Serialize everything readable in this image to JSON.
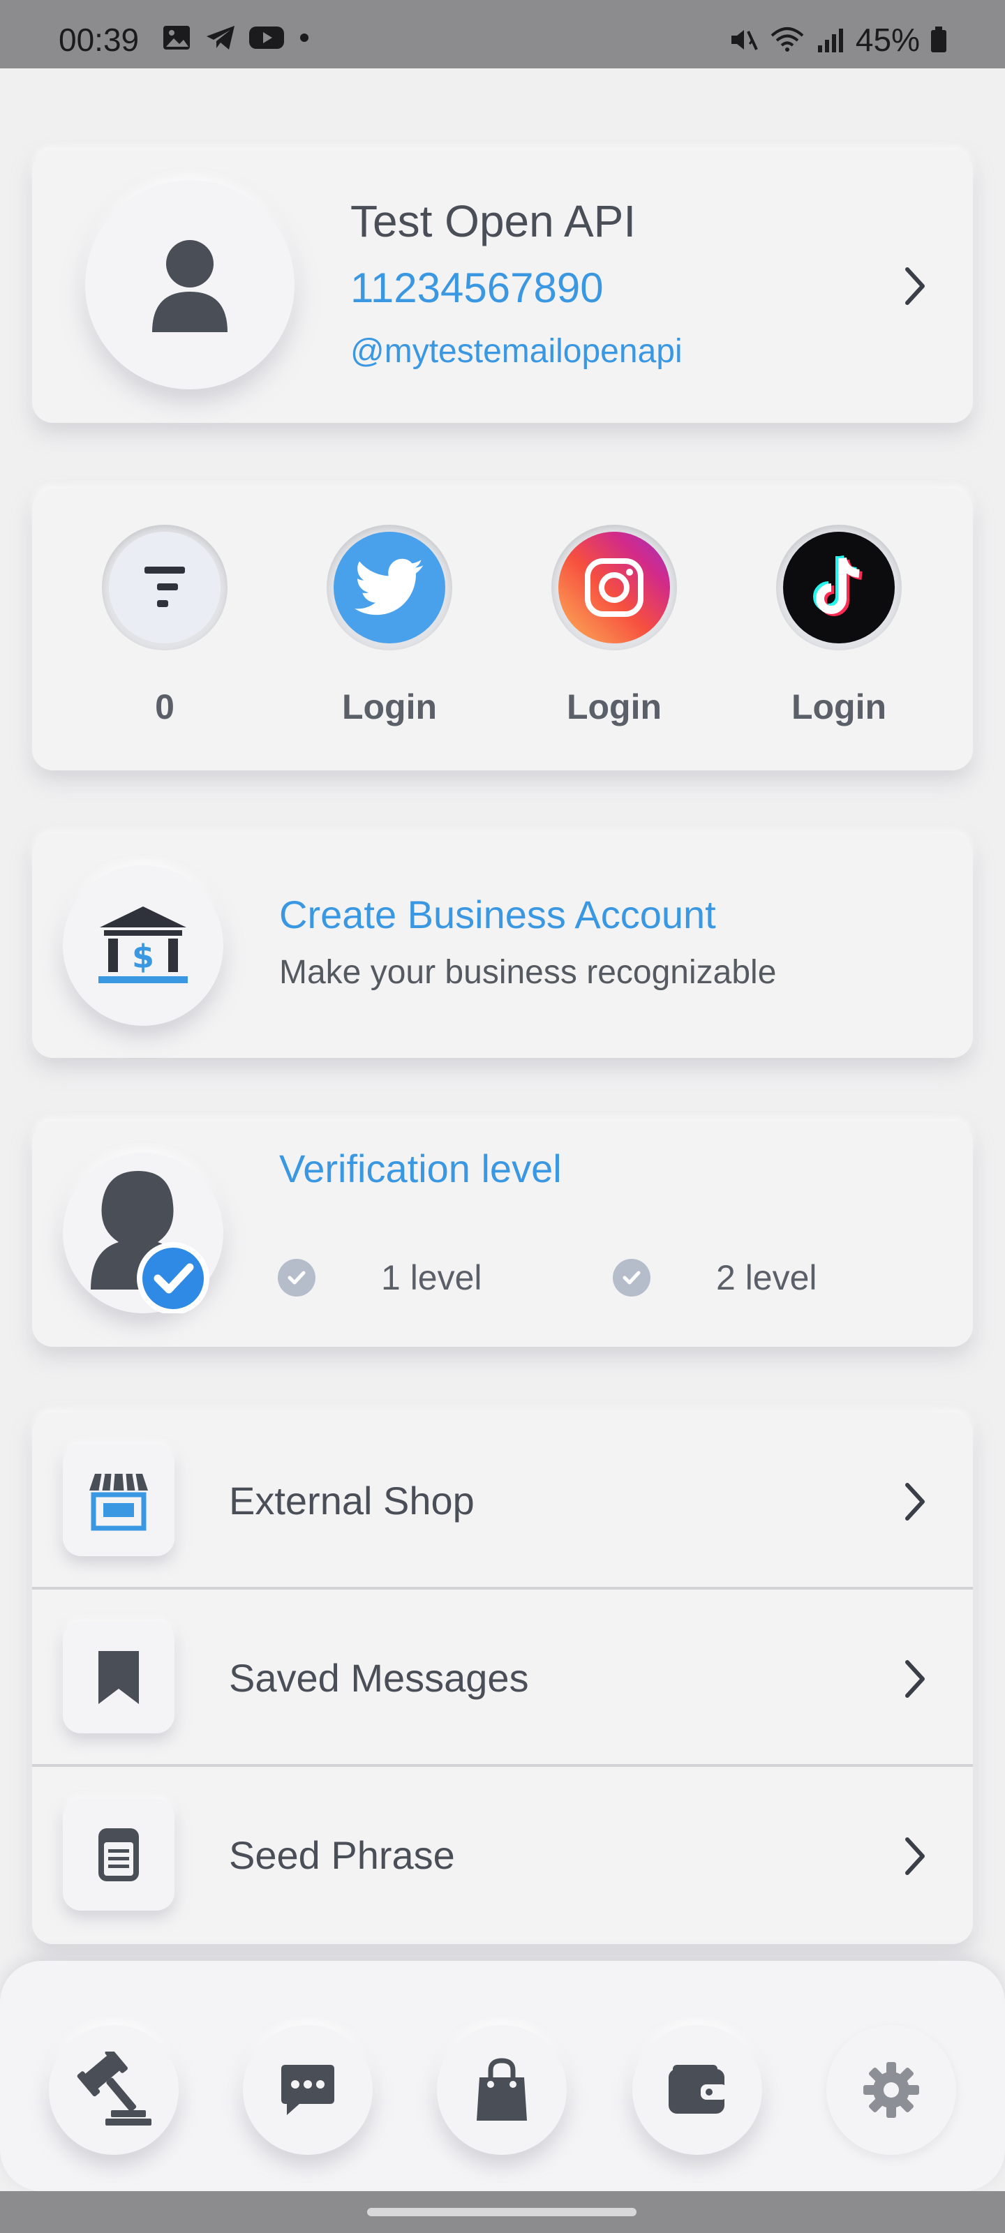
{
  "status_bar": {
    "time": "00:39",
    "battery": "45%",
    "left_icons": [
      "image-icon",
      "telegram-icon",
      "youtube-icon",
      "dot-icon"
    ],
    "right_icons": [
      "mute-icon",
      "wifi-icon",
      "signal-icon",
      "battery-icon"
    ]
  },
  "profile": {
    "name": "Test Open API",
    "phone": "11234567890",
    "handle": "@mytestemailopenapi"
  },
  "social": [
    {
      "id": "token",
      "label": "0"
    },
    {
      "id": "twitter",
      "label": "Login"
    },
    {
      "id": "instagram",
      "label": "Login"
    },
    {
      "id": "tiktok",
      "label": "Login"
    }
  ],
  "business": {
    "title": "Create Business Account",
    "subtitle": "Make your business recognizable"
  },
  "verification": {
    "title": "Verification level",
    "levels": [
      "1 level",
      "2 level"
    ]
  },
  "menu": [
    {
      "label": "External Shop",
      "icon": "shop-icon"
    },
    {
      "label": "Saved Messages",
      "icon": "bookmark-icon"
    },
    {
      "label": "Seed Phrase",
      "icon": "document-icon"
    }
  ],
  "bottom_nav": [
    "gavel-icon",
    "chat-icon",
    "shopping-bag-icon",
    "wallet-icon",
    "gear-icon"
  ],
  "colors": {
    "accent": "#3a97e2",
    "background": "#f0f0f1",
    "text": "#4a4e57"
  }
}
